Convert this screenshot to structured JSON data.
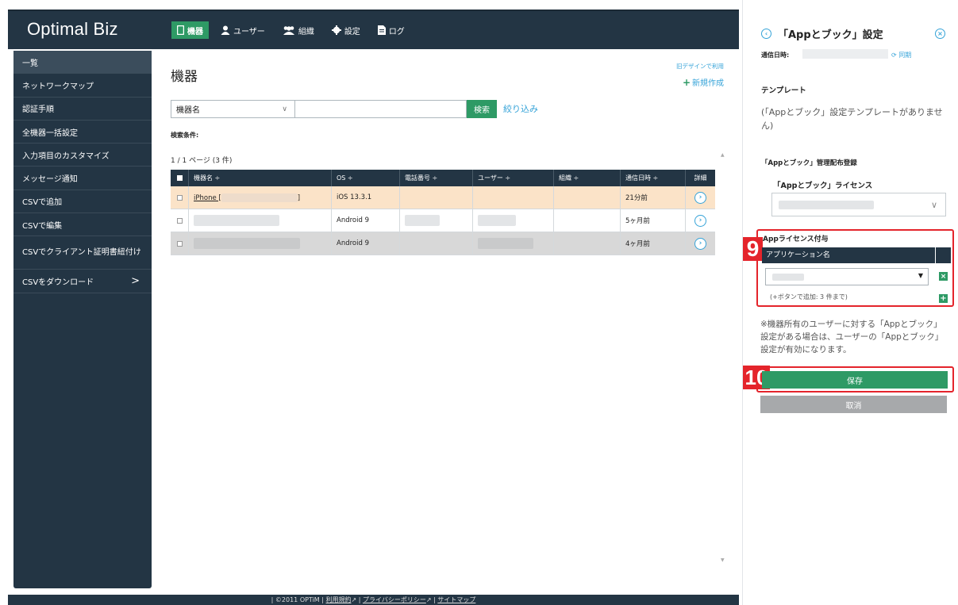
{
  "app": {
    "logo": "Optimal Biz"
  },
  "nav": {
    "items": [
      {
        "label": "機器",
        "icon": "device-icon"
      },
      {
        "label": "ユーザー",
        "icon": "user-icon"
      },
      {
        "label": "組織",
        "icon": "group-icon"
      },
      {
        "label": "設定",
        "icon": "gear-icon"
      },
      {
        "label": "ログ",
        "icon": "document-icon"
      }
    ]
  },
  "sidebar": {
    "items": [
      {
        "label": "一覧"
      },
      {
        "label": "ネットワークマップ"
      },
      {
        "label": "認証手順"
      },
      {
        "label": "全機器一括設定"
      },
      {
        "label": "入力項目のカスタマイズ"
      },
      {
        "label": "メッセージ通知"
      },
      {
        "label": "CSVで追加"
      },
      {
        "label": "CSVで編集"
      },
      {
        "label": "CSVでクライアント証明書紐付け"
      },
      {
        "label": "CSVをダウンロード",
        "chevron": ">"
      }
    ]
  },
  "main": {
    "title": "機器",
    "old_design": "旧デザインで利用",
    "new_button": "新規作成",
    "search": {
      "field_select": "機器名",
      "input_value": "",
      "search_button": "検索",
      "filter_link": "絞り込み"
    },
    "conditions_label": "検索条件:",
    "page_info": "1 / 1 ページ (3 件)",
    "table": {
      "headers": [
        "",
        "機器名 ÷",
        "OS ÷",
        "電話番号 ÷",
        "ユーザー ÷",
        "組織 ÷",
        "通信日時 ÷",
        "詳細"
      ],
      "rows": [
        {
          "name": "iPhone [",
          "name_suffix": "]",
          "os": "iOS 13.3.1",
          "last_comm": "21分前"
        },
        {
          "name": "",
          "name_suffix": "",
          "os": "Android 9",
          "last_comm": "5ヶ月前"
        },
        {
          "name": "",
          "name_suffix": "",
          "os": "Android 9",
          "last_comm": "4ヶ月前"
        }
      ]
    }
  },
  "footer": {
    "copyright": "| ©2011 OPTiM |",
    "terms": "利用規約",
    "sep1": "|",
    "privacy": "プライバシーポリシー",
    "sep2": "|",
    "sitemap": "サイトマップ"
  },
  "panel": {
    "title": "「Appとブック」設定",
    "sync_label": "通信日時:",
    "sync_link": "同期",
    "template_label": "テンプレート",
    "template_none": "(「Appとブック」設定テンプレートがありません)",
    "registration_label": "「Appとブック」管理配布登録",
    "license_label": "「Appとブック」ライセンス",
    "license_select_value": "",
    "applic_label": "Appライセンス付与",
    "applic_header": "アプリケーション名",
    "applic_hint": "(+ボタンで追加: 3 件まで)",
    "note": "※機器所有のユーザーに対する「Appとブック」設定がある場合は、ユーザーの「Appとブック」設定が有効になります。",
    "save_button": "保存",
    "cancel_button": "取消",
    "badge9": "9",
    "badge10": "10"
  },
  "colors": {
    "navy": "#233544",
    "green": "#2e9a65",
    "link_blue": "#35a3d8",
    "highlight_red": "#e4242b",
    "selected_row": "#fbe3c8"
  }
}
